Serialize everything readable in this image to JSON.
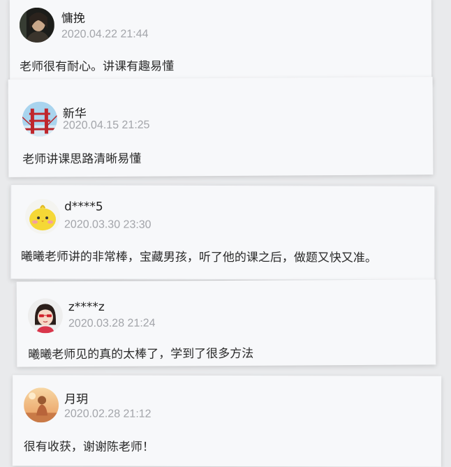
{
  "comments": [
    {
      "user": "慵挽",
      "time": "2020.04.22 21:44",
      "text": "老师很有耐心。讲课有趣易懂",
      "avatar": "dark-portrait-avatar"
    },
    {
      "user": "新华",
      "time": "2020.04.15 21:25",
      "text": "老师讲课思路清晰易懂",
      "avatar": "red-bridge-avatar"
    },
    {
      "user": "d****5",
      "time": "2020.03.30 23:30",
      "text": "曦曦老师讲的非常棒，宝藏男孩，听了他的课之后，做题又快又准。",
      "avatar": "yellow-chick-avatar"
    },
    {
      "user": "z****z",
      "time": "2020.03.28 21:24",
      "text": "曦曦老师见的真的太棒了，学到了很多方法",
      "avatar": "cartoon-girl-avatar"
    },
    {
      "user": "月玥",
      "time": "2020.02.28 21:12",
      "text": "很有收获，谢谢陈老师！",
      "avatar": "sunset-figure-avatar"
    }
  ],
  "colors": {
    "background": "#e9eaec",
    "card": "#f7f8fa",
    "username": "#222222",
    "timestamp": "#a3a5aa",
    "content": "#2a2a2a"
  }
}
